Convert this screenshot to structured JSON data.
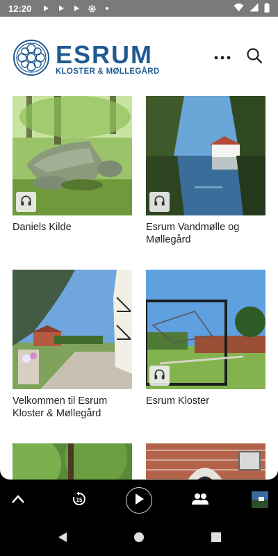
{
  "status_bar": {
    "time": "12:20",
    "left_icons": [
      "play-icon",
      "play-icon",
      "play-icon",
      "settings-icon",
      "dot-icon"
    ],
    "right_icons": [
      "wifi-icon",
      "signal-icon",
      "battery-icon"
    ]
  },
  "header": {
    "logo_title": "ESRUM",
    "logo_subtitle": "KLOSTER & MØLLEGÅRD",
    "brand_color": "#1f5a94",
    "actions": [
      "more-icon",
      "search-icon"
    ]
  },
  "cards": [
    {
      "title": "Daniels Kilde",
      "has_audio": true
    },
    {
      "title": "Esrum Vandmølle og Møllegård",
      "has_audio": true
    },
    {
      "title": "Velkommen til Esrum Kloster & Møllegård",
      "has_audio": false
    },
    {
      "title": "Esrum Kloster",
      "has_audio": true
    },
    {
      "title": "",
      "has_audio": false
    },
    {
      "title": "",
      "has_audio": false
    }
  ],
  "player": {
    "buttons": [
      "chevron-up-icon",
      "replay-15-icon",
      "play-icon",
      "group-icon",
      "thumbnail"
    ],
    "replay_seconds": "15"
  },
  "navbar": {
    "buttons": [
      "back-icon",
      "home-icon",
      "recents-icon"
    ]
  }
}
